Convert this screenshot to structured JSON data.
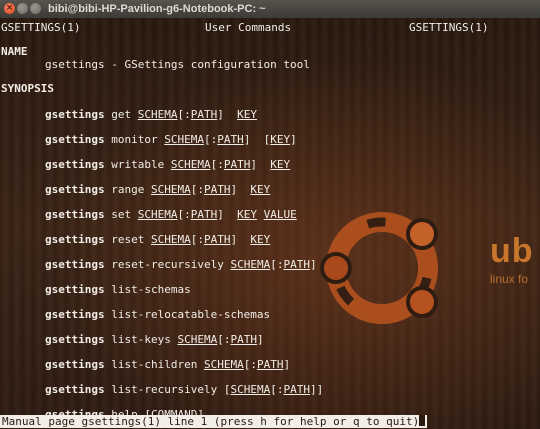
{
  "window": {
    "title": "bibi@bibi-HP-Pavilion-g6-Notebook-PC: ~",
    "close_glyph": "×"
  },
  "man": {
    "header_left": "GSETTINGS(1)",
    "header_center": "User Commands",
    "header_right": "GSETTINGS(1)",
    "name_heading": "NAME",
    "name_desc": "gsettings - GSettings configuration tool",
    "synopsis_heading": "SYNOPSIS",
    "command": "gsettings",
    "synopsis": [
      {
        "sub": "get",
        "args": [
          "SCHEMA",
          "[:",
          "PATH",
          "]",
          "KEY"
        ]
      },
      {
        "sub": "monitor",
        "args": [
          "SCHEMA",
          "[:",
          "PATH",
          "]",
          "[",
          "KEY",
          "]"
        ]
      },
      {
        "sub": "writable",
        "args": [
          "SCHEMA",
          "[:",
          "PATH",
          "]",
          "KEY"
        ]
      },
      {
        "sub": "range",
        "args": [
          "SCHEMA",
          "[:",
          "PATH",
          "]",
          "KEY"
        ]
      },
      {
        "sub": "set",
        "args": [
          "SCHEMA",
          "[:",
          "PATH",
          "]",
          "KEY",
          "VALUE"
        ]
      },
      {
        "sub": "reset",
        "args": [
          "SCHEMA",
          "[:",
          "PATH",
          "]",
          "KEY"
        ]
      },
      {
        "sub": "reset-recursively",
        "args": [
          "SCHEMA",
          "[:",
          "PATH",
          "]"
        ]
      },
      {
        "sub": "list-schemas",
        "args": []
      },
      {
        "sub": "list-relocatable-schemas",
        "args": []
      },
      {
        "sub": "list-keys",
        "args": [
          "SCHEMA",
          "[:",
          "PATH",
          "]"
        ]
      },
      {
        "sub": "list-children",
        "args": [
          "SCHEMA",
          "[:",
          "PATH",
          "]"
        ]
      },
      {
        "sub": "list-recursively",
        "args": [
          "[",
          "SCHEMA",
          "[:",
          "PATH",
          "]]"
        ]
      },
      {
        "sub": "help",
        "args": [
          "[",
          "COMMAND",
          "]"
        ]
      }
    ],
    "status_line": "Manual page gsettings(1) line 1 (press h for help or q to quit)"
  },
  "wallpaper": {
    "brand_word": "ub",
    "brand_tagline": "linux fo",
    "accent": "#dd4814"
  }
}
